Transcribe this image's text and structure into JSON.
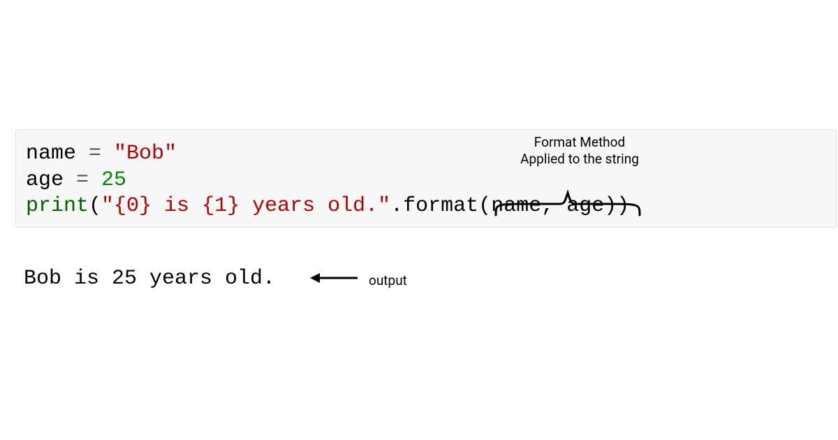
{
  "code": {
    "line1": {
      "var": "name",
      "eq": " = ",
      "q1": "\"",
      "str": "Bob",
      "q2": "\""
    },
    "line2": {
      "var": "age",
      "eq": " = ",
      "num": "25"
    },
    "line3": {
      "func": "print",
      "open": "(",
      "q1": "\"",
      "str": "{0} is {1} years old.",
      "q2": "\"",
      "dot": ".",
      "method": "format",
      "open2": "(",
      "arg1": "name",
      "comma": ", ",
      "arg2": "age",
      "close2": ")",
      "close": ")"
    }
  },
  "output": "Bob is 25 years old.",
  "annotations": {
    "format_method": "Format Method Applied to the string",
    "output_label": "output"
  }
}
